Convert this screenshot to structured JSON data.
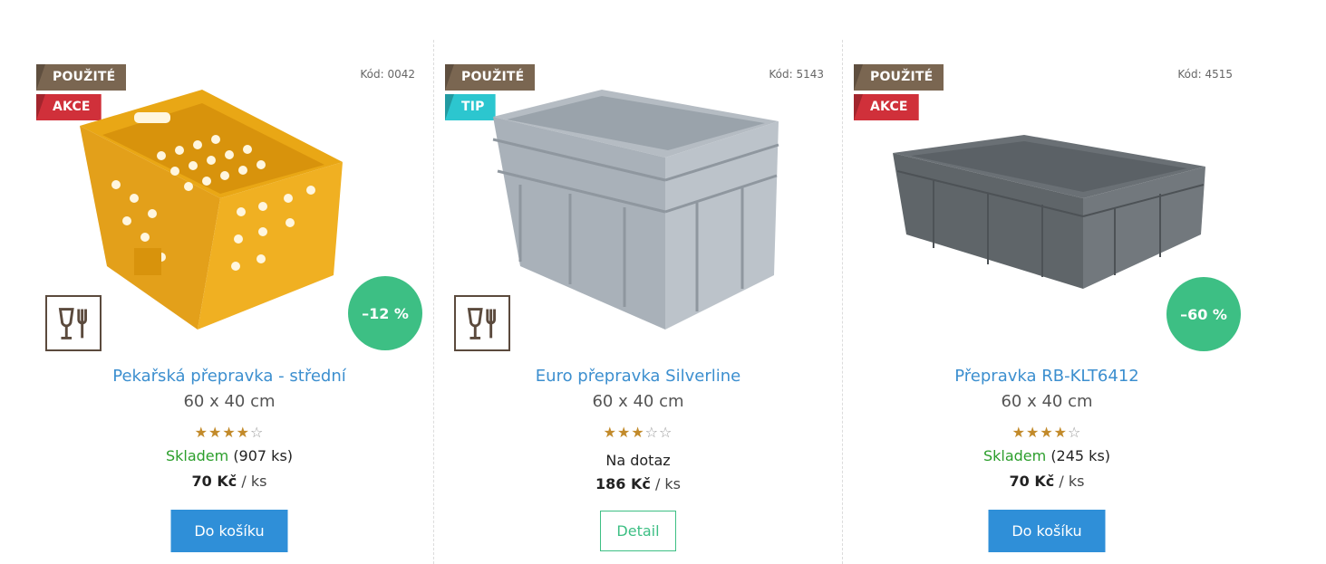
{
  "products": [
    {
      "flags": [
        "POUŽITÉ",
        "AKCE"
      ],
      "code": "Kód: 0042",
      "discount": "–12 %",
      "name": "Pekařská přepravka - střední",
      "size": "60 x 40 cm",
      "rating": 4,
      "rating_max": 5,
      "stock_label": "Skladem",
      "stock_qty": "(907 ks)",
      "price": "70 Kč",
      "unit": "/ ks",
      "button": "Do košíku",
      "food_safe": true,
      "image": "yellow-perforated-crate"
    },
    {
      "flags": [
        "POUŽITÉ",
        "TIP"
      ],
      "code": "Kód: 5143",
      "discount": "",
      "name": "Euro přepravka Silverline",
      "size": "60 x 40 cm",
      "rating": 3,
      "rating_max": 5,
      "stock_label": "Na dotaz",
      "stock_qty": "",
      "price": "186 Kč",
      "unit": "/ ks",
      "button": "Detail",
      "food_safe": true,
      "image": "grey-euro-crate"
    },
    {
      "flags": [
        "POUŽITÉ",
        "AKCE"
      ],
      "code": "Kód: 4515",
      "discount": "–60 %",
      "name": "Přepravka RB-KLT6412",
      "size": "60 x 40 cm",
      "rating": 4,
      "rating_max": 5,
      "stock_label": "Skladem",
      "stock_qty": "(245 ks)",
      "price": "70 Kč",
      "unit": "/ ks",
      "button": "Do košíku",
      "food_safe": false,
      "image": "dark-grey-flat-crate"
    }
  ],
  "colors": {
    "flag_used": "#7a6651",
    "flag_sale": "#d0303a",
    "flag_tip": "#2cc6cf",
    "discount": "#3dbf84",
    "link": "#3c8fcf",
    "in_stock": "#2b9e2b",
    "cart_button": "#2f8fd8",
    "star": "#c28a2a"
  },
  "icons": {
    "food_safe": "glass-fork-icon",
    "star_full": "star-filled-icon",
    "star_empty": "star-outline-icon"
  }
}
